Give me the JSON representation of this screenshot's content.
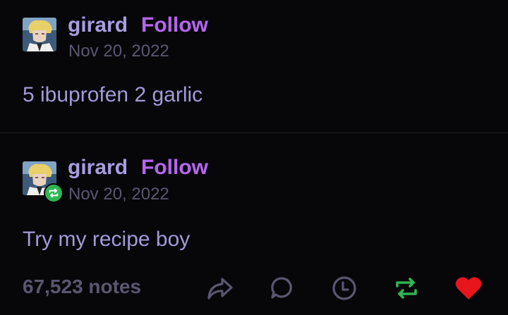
{
  "posts": [
    {
      "username": "girard",
      "follow_label": "Follow",
      "date": "Nov 20, 2022",
      "body": "5 ibuprofen 2 garlic"
    },
    {
      "username": "girard",
      "follow_label": "Follow",
      "date": "Nov 20, 2022",
      "body": "Try my recipe boy",
      "reblogged": true,
      "notes": "67,523 notes",
      "actions": [
        "share-icon",
        "reply-icon",
        "history-icon",
        "reblog-icon",
        "like-icon"
      ]
    }
  ],
  "colors": {
    "background": "#07070a",
    "username": "#a89ce0",
    "follow": "#b766f0",
    "muted": "#5b5670",
    "body": "#a29ad8",
    "reblog_green": "#2fb552",
    "like_red": "#e8151c"
  }
}
